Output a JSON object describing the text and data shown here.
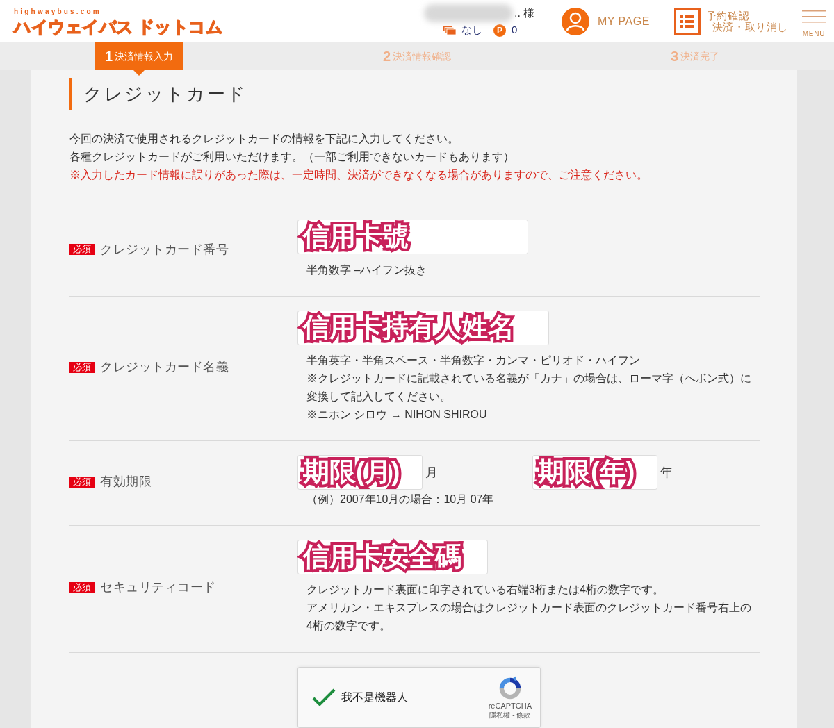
{
  "header": {
    "logo_small": "highwaybus.com",
    "logo": "ハイウェイバス ドットコム",
    "user_suffix": ".. 様",
    "coupons": "なし",
    "points_badge": "P",
    "points": "0",
    "mypage": "MY PAGE",
    "reservation_lines": [
      "予約確認",
      "決済・取り消し"
    ],
    "menu": "MENU"
  },
  "steps": [
    {
      "number": "1",
      "label": "決済情報入力",
      "selected": true
    },
    {
      "number": "2",
      "label": "決済情報確認",
      "selected": false
    },
    {
      "number": "3",
      "label": "決済完了",
      "selected": false
    }
  ],
  "title": "クレジットカード",
  "intro": [
    {
      "kind": "normal",
      "text": "今回の決済で使用されるクレジットカードの情報を下記に入力してください。"
    },
    {
      "kind": "normal",
      "text": "各種クレジットカードがご利用いただけます。（一部ご利用できないカードもあります）"
    },
    {
      "kind": "warning",
      "text": "※入力したカード情報に誤りがあった際は、一定時間、決済ができなくなる場合がありますので、ご注意ください。"
    }
  ],
  "fields": [
    {
      "kind": "single",
      "required_badge": "必須",
      "label": "クレジットカード番号",
      "annotation": "信用卡號",
      "hints": [
        "半角数字 –ハイフン抜き"
      ]
    },
    {
      "kind": "single",
      "required_badge": "必須",
      "label": "クレジットカード名義",
      "annotation": "信用卡持有人姓名",
      "hints": [
        "半角英字・半角スペース・半角数字・カンマ・ピリオド・ハイフン",
        "※クレジットカードに記載されている名義が「カナ」の場合は、ローマ字（ヘボン式）に変換して記入してください。",
        "※ニホン シロウ → NIHON SHIROU"
      ]
    },
    {
      "kind": "expiry",
      "required_badge": "必須",
      "label": "有効期限",
      "parts": [
        {
          "annotation": "期限(月)",
          "unit": "月"
        },
        {
          "annotation": "期限(年)",
          "unit": "年"
        }
      ],
      "hints": [
        "（例）2007年10月の場合：10月 07年"
      ]
    },
    {
      "kind": "single",
      "required_badge": "必須",
      "label": "セキュリティコード",
      "annotation": "信用卡安全碼",
      "hints": [
        "クレジットカード裏面に印字されている右端3桁または4桁の数字です。",
        "アメリカン・エキスプレスの場合はクレジットカード表面のクレジットカード番号右上の4桁の数字です。"
      ]
    }
  ],
  "captcha": {
    "checked": true,
    "label": "我不是機器人",
    "brand": "reCAPTCHA",
    "links": "隱私權 - 條款"
  }
}
